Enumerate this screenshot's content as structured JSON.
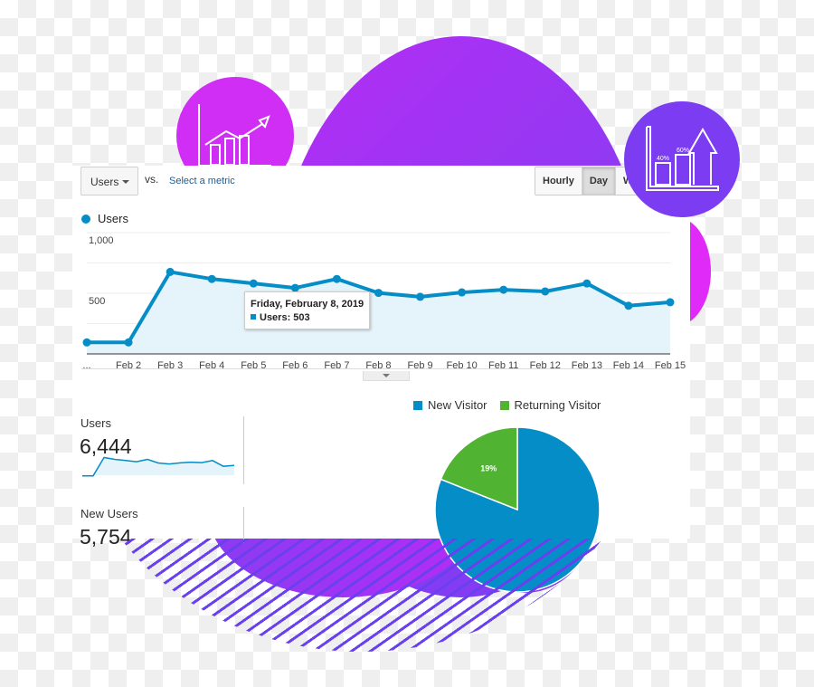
{
  "toolbar": {
    "metric_select": "Users",
    "vs_label": "vs.",
    "select_metric_link": "Select a metric",
    "granularity_buttons": [
      {
        "label": "Hourly",
        "active": false
      },
      {
        "label": "Day",
        "active": true
      },
      {
        "label": "We",
        "active": false
      }
    ]
  },
  "icons": {
    "left_circle": "growth-chart-arrow-icon",
    "right_circle": "bar-chart-up-arrow-icon",
    "right_circle_labels": [
      "40%",
      "60%"
    ]
  },
  "tooltip": {
    "date": "Friday, February 8, 2019",
    "series_label": "Users: 503"
  },
  "metrics": [
    {
      "label": "Users",
      "value": "6,444"
    },
    {
      "label": "New Users",
      "value": "5,754"
    }
  ],
  "colors": {
    "series": "#058dc7",
    "area": "#e5f3fa",
    "new_visitor": "#058dc7",
    "returning_visitor": "#50b432"
  },
  "chart_data": [
    {
      "type": "line",
      "title": "",
      "legend": [
        "Users"
      ],
      "legend_position": "top-left",
      "x": [
        "...",
        "Feb 2",
        "Feb 3",
        "Feb 4",
        "Feb 5",
        "Feb 6",
        "Feb 7",
        "Feb 8",
        "Feb 9",
        "Feb 10",
        "Feb 11",
        "Feb 12",
        "Feb 13",
        "Feb 14",
        "Feb 15"
      ],
      "series": [
        {
          "name": "Users",
          "values": [
            95,
            95,
            676,
            618,
            581,
            544,
            618,
            503,
            471,
            507,
            529,
            515,
            581,
            397,
            426
          ]
        }
      ],
      "yticks": [
        "500",
        "1,000"
      ],
      "ytick_values": [
        500,
        1000
      ],
      "ylim": [
        0,
        1000
      ],
      "grid": true,
      "xlabel": "",
      "ylabel": ""
    },
    {
      "type": "pie",
      "title": "",
      "legend_position": "top",
      "categories": [
        "New Visitor",
        "Returning Visitor"
      ],
      "values": [
        81,
        19
      ],
      "data_labels": [
        "",
        "19%"
      ]
    }
  ]
}
